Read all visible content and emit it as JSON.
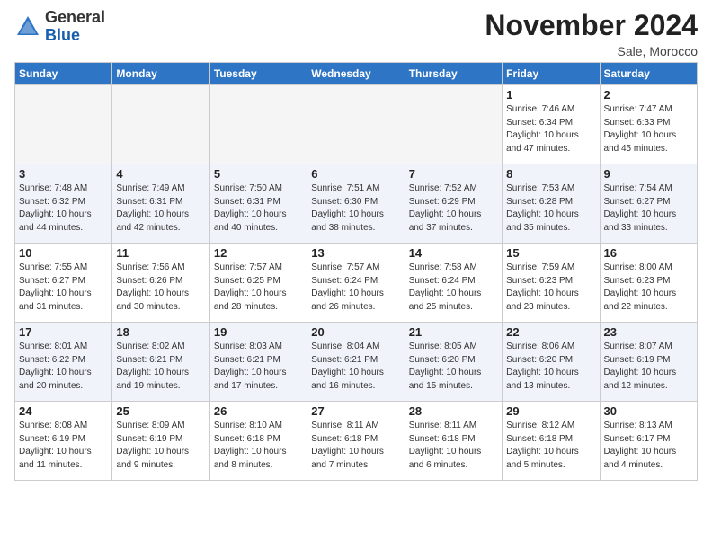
{
  "header": {
    "logo_general": "General",
    "logo_blue": "Blue",
    "month": "November 2024",
    "location": "Sale, Morocco"
  },
  "weekdays": [
    "Sunday",
    "Monday",
    "Tuesday",
    "Wednesday",
    "Thursday",
    "Friday",
    "Saturday"
  ],
  "weeks": [
    [
      {
        "day": "",
        "info": ""
      },
      {
        "day": "",
        "info": ""
      },
      {
        "day": "",
        "info": ""
      },
      {
        "day": "",
        "info": ""
      },
      {
        "day": "",
        "info": ""
      },
      {
        "day": "1",
        "info": "Sunrise: 7:46 AM\nSunset: 6:34 PM\nDaylight: 10 hours and 47 minutes."
      },
      {
        "day": "2",
        "info": "Sunrise: 7:47 AM\nSunset: 6:33 PM\nDaylight: 10 hours and 45 minutes."
      }
    ],
    [
      {
        "day": "3",
        "info": "Sunrise: 7:48 AM\nSunset: 6:32 PM\nDaylight: 10 hours and 44 minutes."
      },
      {
        "day": "4",
        "info": "Sunrise: 7:49 AM\nSunset: 6:31 PM\nDaylight: 10 hours and 42 minutes."
      },
      {
        "day": "5",
        "info": "Sunrise: 7:50 AM\nSunset: 6:31 PM\nDaylight: 10 hours and 40 minutes."
      },
      {
        "day": "6",
        "info": "Sunrise: 7:51 AM\nSunset: 6:30 PM\nDaylight: 10 hours and 38 minutes."
      },
      {
        "day": "7",
        "info": "Sunrise: 7:52 AM\nSunset: 6:29 PM\nDaylight: 10 hours and 37 minutes."
      },
      {
        "day": "8",
        "info": "Sunrise: 7:53 AM\nSunset: 6:28 PM\nDaylight: 10 hours and 35 minutes."
      },
      {
        "day": "9",
        "info": "Sunrise: 7:54 AM\nSunset: 6:27 PM\nDaylight: 10 hours and 33 minutes."
      }
    ],
    [
      {
        "day": "10",
        "info": "Sunrise: 7:55 AM\nSunset: 6:27 PM\nDaylight: 10 hours and 31 minutes."
      },
      {
        "day": "11",
        "info": "Sunrise: 7:56 AM\nSunset: 6:26 PM\nDaylight: 10 hours and 30 minutes."
      },
      {
        "day": "12",
        "info": "Sunrise: 7:57 AM\nSunset: 6:25 PM\nDaylight: 10 hours and 28 minutes."
      },
      {
        "day": "13",
        "info": "Sunrise: 7:57 AM\nSunset: 6:24 PM\nDaylight: 10 hours and 26 minutes."
      },
      {
        "day": "14",
        "info": "Sunrise: 7:58 AM\nSunset: 6:24 PM\nDaylight: 10 hours and 25 minutes."
      },
      {
        "day": "15",
        "info": "Sunrise: 7:59 AM\nSunset: 6:23 PM\nDaylight: 10 hours and 23 minutes."
      },
      {
        "day": "16",
        "info": "Sunrise: 8:00 AM\nSunset: 6:23 PM\nDaylight: 10 hours and 22 minutes."
      }
    ],
    [
      {
        "day": "17",
        "info": "Sunrise: 8:01 AM\nSunset: 6:22 PM\nDaylight: 10 hours and 20 minutes."
      },
      {
        "day": "18",
        "info": "Sunrise: 8:02 AM\nSunset: 6:21 PM\nDaylight: 10 hours and 19 minutes."
      },
      {
        "day": "19",
        "info": "Sunrise: 8:03 AM\nSunset: 6:21 PM\nDaylight: 10 hours and 17 minutes."
      },
      {
        "day": "20",
        "info": "Sunrise: 8:04 AM\nSunset: 6:21 PM\nDaylight: 10 hours and 16 minutes."
      },
      {
        "day": "21",
        "info": "Sunrise: 8:05 AM\nSunset: 6:20 PM\nDaylight: 10 hours and 15 minutes."
      },
      {
        "day": "22",
        "info": "Sunrise: 8:06 AM\nSunset: 6:20 PM\nDaylight: 10 hours and 13 minutes."
      },
      {
        "day": "23",
        "info": "Sunrise: 8:07 AM\nSunset: 6:19 PM\nDaylight: 10 hours and 12 minutes."
      }
    ],
    [
      {
        "day": "24",
        "info": "Sunrise: 8:08 AM\nSunset: 6:19 PM\nDaylight: 10 hours and 11 minutes."
      },
      {
        "day": "25",
        "info": "Sunrise: 8:09 AM\nSunset: 6:19 PM\nDaylight: 10 hours and 9 minutes."
      },
      {
        "day": "26",
        "info": "Sunrise: 8:10 AM\nSunset: 6:18 PM\nDaylight: 10 hours and 8 minutes."
      },
      {
        "day": "27",
        "info": "Sunrise: 8:11 AM\nSunset: 6:18 PM\nDaylight: 10 hours and 7 minutes."
      },
      {
        "day": "28",
        "info": "Sunrise: 8:11 AM\nSunset: 6:18 PM\nDaylight: 10 hours and 6 minutes."
      },
      {
        "day": "29",
        "info": "Sunrise: 8:12 AM\nSunset: 6:18 PM\nDaylight: 10 hours and 5 minutes."
      },
      {
        "day": "30",
        "info": "Sunrise: 8:13 AM\nSunset: 6:17 PM\nDaylight: 10 hours and 4 minutes."
      }
    ]
  ]
}
